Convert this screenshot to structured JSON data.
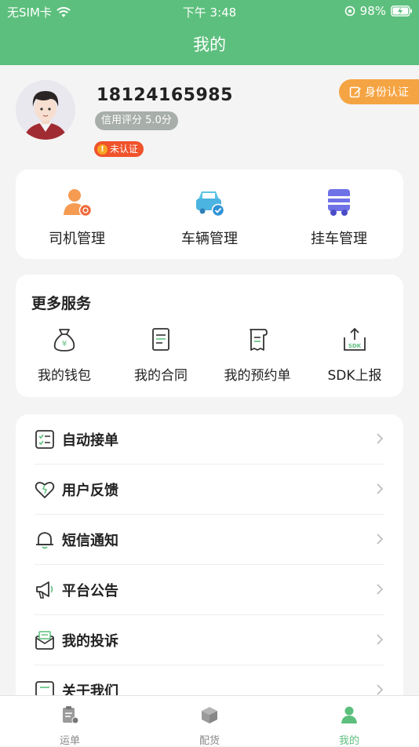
{
  "status_bar": {
    "carrier": "无SIM卡",
    "time": "下午 3:48",
    "battery": "98%"
  },
  "header": {
    "title": "我的"
  },
  "profile": {
    "phone": "18124165985",
    "credit_score": "信用评分 5.0分",
    "verify_status": "未认证",
    "id_auth_button": "身份认证"
  },
  "management": [
    {
      "label": "司机管理",
      "icon": "driver-icon"
    },
    {
      "label": "车辆管理",
      "icon": "vehicle-icon"
    },
    {
      "label": "挂车管理",
      "icon": "trailer-icon"
    }
  ],
  "more_services": {
    "title": "更多服务",
    "items": [
      {
        "label": "我的钱包",
        "icon": "wallet-icon"
      },
      {
        "label": "我的合同",
        "icon": "contract-icon"
      },
      {
        "label": "我的预约单",
        "icon": "reservation-icon"
      },
      {
        "label": "SDK上报",
        "icon": "sdk-upload-icon"
      }
    ]
  },
  "menu": [
    {
      "label": "自动接单",
      "icon": "checklist-icon"
    },
    {
      "label": "用户反馈",
      "icon": "heart-icon"
    },
    {
      "label": "短信通知",
      "icon": "bell-icon"
    },
    {
      "label": "平台公告",
      "icon": "megaphone-icon"
    },
    {
      "label": "我的投诉",
      "icon": "complaint-icon"
    },
    {
      "label": "关于我们",
      "icon": "about-icon"
    }
  ],
  "tabbar": [
    {
      "label": "运单",
      "icon": "waybill-icon",
      "active": false
    },
    {
      "label": "配货",
      "icon": "cargo-box-icon",
      "active": false
    },
    {
      "label": "我的",
      "icon": "profile-icon",
      "active": true
    }
  ],
  "colors": {
    "brand": "#5dbf7d",
    "accent": "#f5a443",
    "warning": "#f0522b"
  }
}
